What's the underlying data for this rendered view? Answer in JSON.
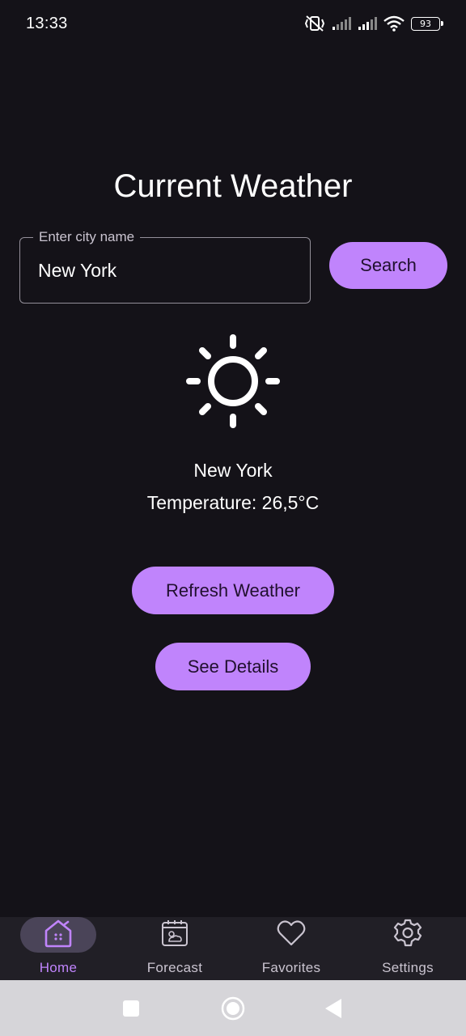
{
  "status_bar": {
    "time": "13:33",
    "battery": "93",
    "icons": [
      "mute-vibrate-icon",
      "signal-icon",
      "signal-icon",
      "wifi-icon",
      "battery-icon"
    ]
  },
  "title": "Current Weather",
  "search": {
    "label": "Enter city name",
    "value": "New York",
    "button": "Search"
  },
  "weather": {
    "icon": "sun-icon",
    "city": "New York",
    "temperature": "Temperature: 26,5°C"
  },
  "actions": {
    "refresh": "Refresh Weather",
    "details": "See Details"
  },
  "nav": {
    "items": [
      {
        "label": "Home",
        "icon": "home-icon",
        "active": true
      },
      {
        "label": "Forecast",
        "icon": "forecast-icon",
        "active": false
      },
      {
        "label": "Favorites",
        "icon": "heart-icon",
        "active": false
      },
      {
        "label": "Settings",
        "icon": "gear-icon",
        "active": false
      }
    ]
  },
  "colors": {
    "background": "#141218",
    "accent": "#c084fc",
    "nav_background": "#211f26"
  }
}
